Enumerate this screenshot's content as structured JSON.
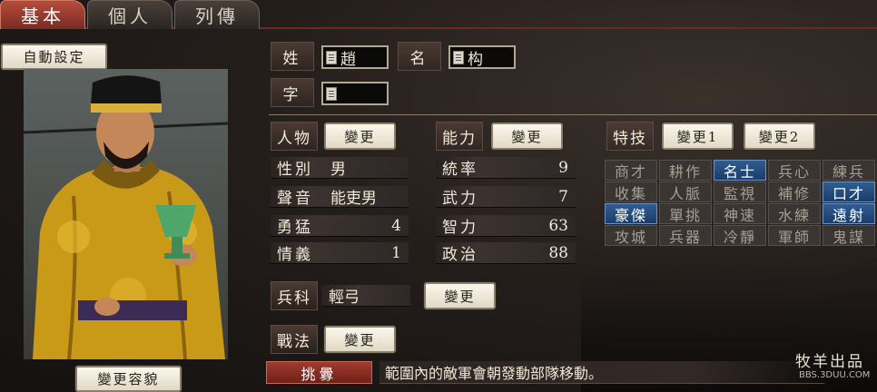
{
  "tabs": [
    "基本",
    "個人",
    "列傳"
  ],
  "buttons": {
    "auto": "自動設定",
    "change_face": "變更容貌",
    "change": "變更",
    "change_skill1": "變更1",
    "change_skill2": "變更2"
  },
  "name": {
    "surname_label": "姓",
    "surname": "趙",
    "given_label": "名",
    "given": "构",
    "style_label": "字",
    "style": ""
  },
  "sections": {
    "person": "人物",
    "ability": "能力",
    "special": "特技",
    "arms": "兵科",
    "tactic": "戰法"
  },
  "person": [
    {
      "k": "性別",
      "v": "男"
    },
    {
      "k": "聲音",
      "v": "能吏男"
    },
    {
      "k": "勇猛",
      "v": "4"
    },
    {
      "k": "情義",
      "v": "1"
    }
  ],
  "ability": [
    {
      "k": "統率",
      "v": "9"
    },
    {
      "k": "武力",
      "v": "7"
    },
    {
      "k": "智力",
      "v": "63"
    },
    {
      "k": "政治",
      "v": "88"
    }
  ],
  "skills": [
    [
      {
        "n": "商才",
        "on": false
      },
      {
        "n": "耕作",
        "on": false
      },
      {
        "n": "名士",
        "on": true
      },
      {
        "n": "兵心",
        "on": false
      },
      {
        "n": "練兵",
        "on": false
      }
    ],
    [
      {
        "n": "收集",
        "on": false
      },
      {
        "n": "人脈",
        "on": false
      },
      {
        "n": "監視",
        "on": false
      },
      {
        "n": "補修",
        "on": false
      },
      {
        "n": "口才",
        "on": true
      }
    ],
    [
      {
        "n": "豪傑",
        "on": true
      },
      {
        "n": "單挑",
        "on": false
      },
      {
        "n": "神速",
        "on": false
      },
      {
        "n": "水練",
        "on": false
      },
      {
        "n": "遠射",
        "on": true
      }
    ],
    [
      {
        "n": "攻城",
        "on": false
      },
      {
        "n": "兵器",
        "on": false
      },
      {
        "n": "冷靜",
        "on": false
      },
      {
        "n": "軍師",
        "on": false
      },
      {
        "n": "鬼謀",
        "on": false
      }
    ]
  ],
  "arms_value": "輕弓",
  "tactic": {
    "name": "挑釁",
    "desc": "範圍內的敵軍會朝發動部隊移動。"
  },
  "watermark": {
    "line1": "牧羊出品",
    "line2": "BBS.3DUU.COM"
  },
  "colors": {
    "accent_red": "#b54d3e",
    "skill_on": "#2f5d92"
  }
}
